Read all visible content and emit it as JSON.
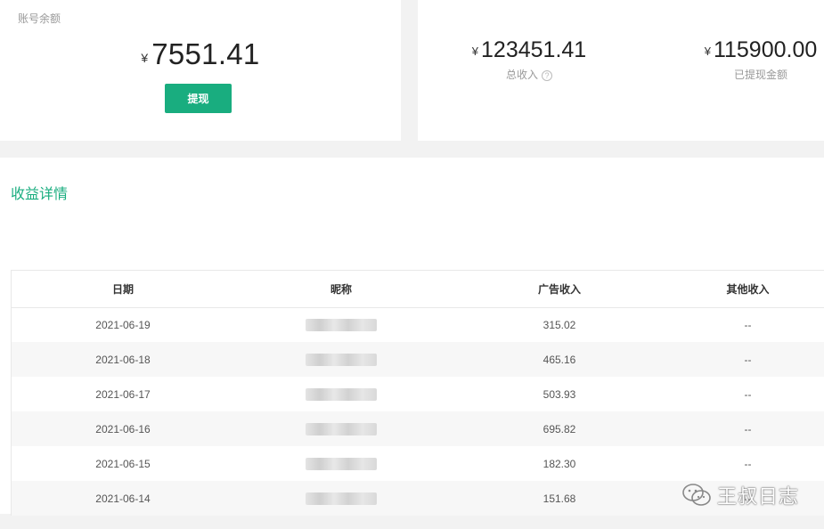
{
  "balance": {
    "label": "账号余额",
    "currency": "¥",
    "amount": "7551.41",
    "withdraw_label": "提现"
  },
  "income": {
    "total": {
      "currency": "¥",
      "amount": "123451.41",
      "label": "总收入",
      "help": "?"
    },
    "withdrawn": {
      "currency": "¥",
      "amount": "115900.00",
      "label": "已提现金额"
    }
  },
  "details": {
    "title": "收益详情",
    "columns": [
      "日期",
      "昵称",
      "广告收入",
      "其他收入"
    ],
    "rows": [
      {
        "date": "2021-06-19",
        "ad_income": "315.02",
        "other_income": "--"
      },
      {
        "date": "2021-06-18",
        "ad_income": "465.16",
        "other_income": "--"
      },
      {
        "date": "2021-06-17",
        "ad_income": "503.93",
        "other_income": "--"
      },
      {
        "date": "2021-06-16",
        "ad_income": "695.82",
        "other_income": "--"
      },
      {
        "date": "2021-06-15",
        "ad_income": "182.30",
        "other_income": "--"
      },
      {
        "date": "2021-06-14",
        "ad_income": "151.68",
        "other_income": "--"
      }
    ]
  },
  "watermark": {
    "text": "王叔日志",
    "icon": "wechat-icon"
  },
  "colors": {
    "accent": "#19ad7f",
    "background": "#f2f2f2",
    "stripe": "#f7f7f7"
  }
}
